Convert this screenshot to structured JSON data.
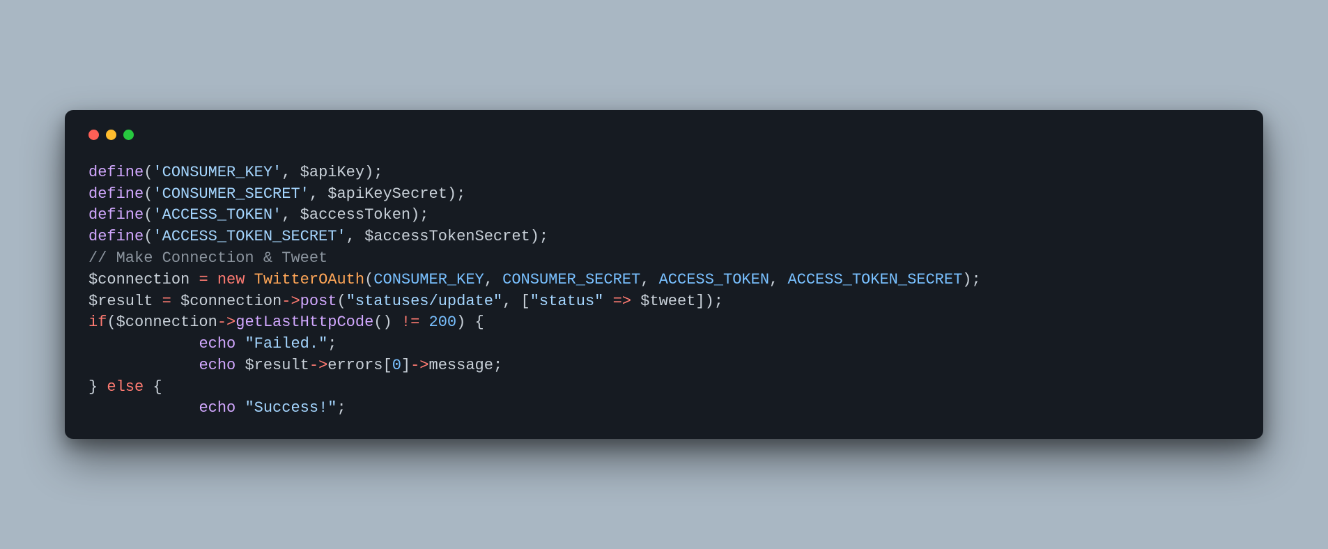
{
  "window": {
    "traffic": {
      "close": "close",
      "minimize": "minimize",
      "zoom": "zoom"
    }
  },
  "code": {
    "define_fn": "define",
    "echo_fn": "echo",
    "post_fn": "post",
    "getlast_fn": "getLastHttpCode",
    "new_kw": "new",
    "if_kw": "if",
    "else_kw": "else",
    "class_twitteroauth": "TwitterOAuth",
    "prop_errors": "errors",
    "prop_message": "message",
    "str_consumer_key": "'CONSUMER_KEY'",
    "str_consumer_secret": "'CONSUMER_SECRET'",
    "str_access_token": "'ACCESS_TOKEN'",
    "str_access_token_secret": "'ACCESS_TOKEN_SECRET'",
    "str_statuses_update": "\"statuses/update\"",
    "str_status": "\"status\"",
    "str_failed": "\"Failed.\"",
    "str_success": "\"Success!\"",
    "var_apiKey": "$apiKey",
    "var_apiKeySecret": "$apiKeySecret",
    "var_accessToken": "$accessToken",
    "var_accessTokenSecret": "$accessTokenSecret",
    "var_connection": "$connection",
    "var_result": "$result",
    "var_tweet": "$tweet",
    "const_consumer_key": "CONSUMER_KEY",
    "const_consumer_secret": "CONSUMER_SECRET",
    "const_access_token": "ACCESS_TOKEN",
    "const_access_token_secret": "ACCESS_TOKEN_SECRET",
    "num_200": "200",
    "num_0": "0",
    "comment_make_connection": "// Make Connection & Tweet",
    "op_assign": "=",
    "op_neq": "!=",
    "op_arrow": "->",
    "op_fatarrow": "=>",
    "indent": "            "
  }
}
